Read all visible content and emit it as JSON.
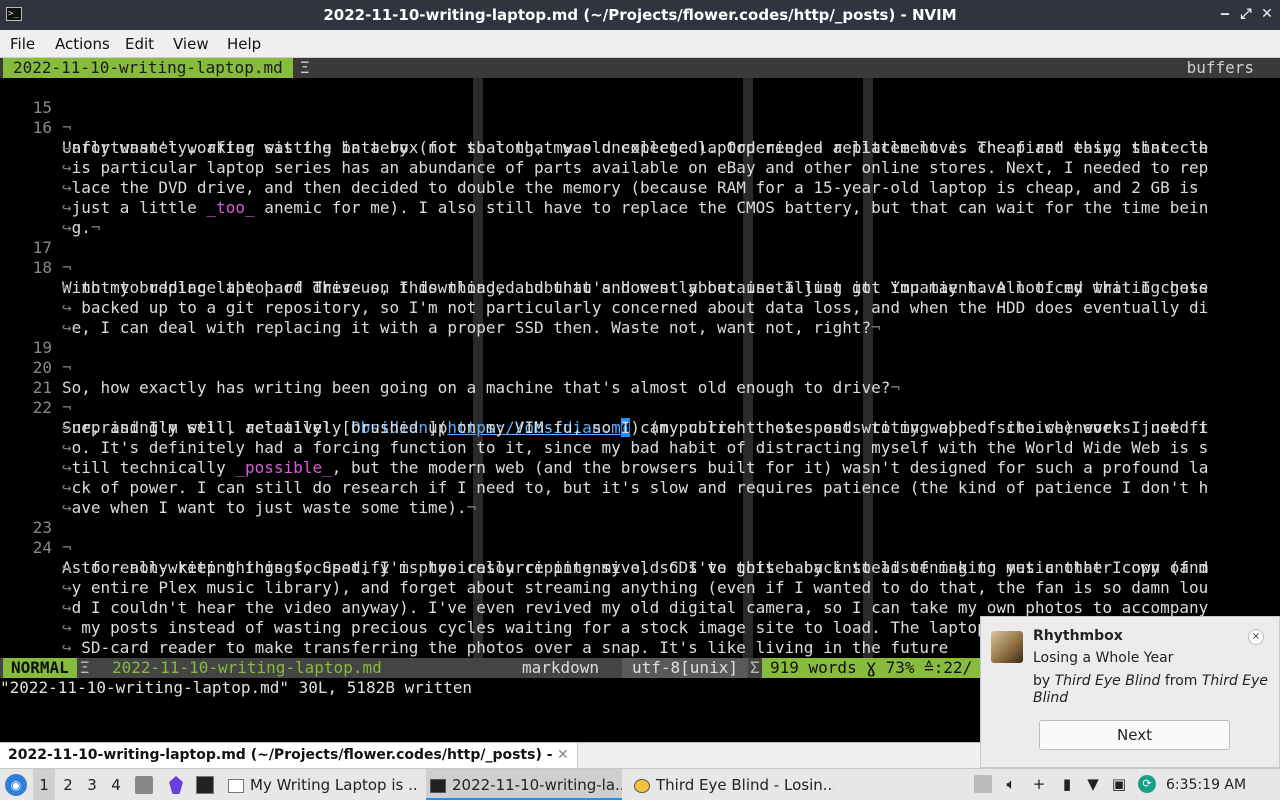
{
  "window": {
    "title": "2022-11-10-writing-laptop.md (~/Projects/flower.codes/http/_posts) - NVIM",
    "minimize": "‒",
    "maximize": "⤢",
    "close": "✕"
  },
  "menu": {
    "items": [
      "File",
      "Actions",
      "Edit",
      "View",
      "Help"
    ]
  },
  "tabline": {
    "active_buffer": "2022-11-10-writing-laptop.md",
    "right_label": "buffers"
  },
  "editor": {
    "wrap_marker": "↪",
    "eol_marker": "¬",
    "line_15": "15",
    "line_16": "16",
    "line_16_a": "Unfortunately, after sitting in a box for so long, my old college laptop needed a little love. The first thing that cle",
    "line_16_b": "arly wasn't working was the battery (not that that was unexpected). Ordering a replacement is cheap and easy, since th",
    "line_16_c": "is particular laptop series has an abundance of parts available on eBay and other online stores. Next, I needed to rep",
    "line_16_d": "lace the DVD drive, and then decided to double the memory (because RAM for a 15-year-old laptop is cheap, and 2 GB is",
    "line_16_e1": "just a little ",
    "line_16_e_em": "_too_",
    "line_16_e2": " anemic for me). I also still have to replace the CMOS battery, but that can wait for the time bein",
    "line_16_f": "g.",
    "line_17": "17",
    "line_18": "18",
    "line_18_a": "With my budding laptop of Theseus, I downloaded Lubuntu and went about installing it. You may have noticed that I chose",
    "line_18_b": " not to replace the hard drive on this thing, and that's honestly because I just got impatient. All of my writing gets",
    "line_18_c": " backed up to a git repository, so I'm not particularly concerned about data loss, and when the HDD does eventually di",
    "line_18_d": "e, I can deal with replacing it with a proper SSD then. Waste not, want not, right?",
    "line_19": "19",
    "line_20": "20",
    "line_20_a": "So, how exactly has writing been going on a machine that's almost old enough to drive?",
    "line_21": "21",
    "line_22": "22",
    "line_22_a1": "Surprisingly well, actually! [",
    "line_22_link": "Obsidian",
    "line_22_a2": "](",
    "line_22_url1": "https://obsidian.m",
    "line_22_cursor": "d",
    "line_22_a3": ") (my current notes and writing app of choice) works just fi",
    "line_22_b": "ne, and I'm still relatively brushed up on my VIM-fu, so I can publish these posts to my webbed site whenever I need t",
    "line_22_c": "o. It's definitely had a forcing function to it, since my bad habit of distracting myself with the World Wide Web is s",
    "line_22_d1": "till technically ",
    "line_22_d_em": "_possible_",
    "line_22_d2": ", but the modern web (and the browsers built for it) wasn't designed for such a profound la",
    "line_22_e": "ck of power. I can still do research if I need to, but it's slow and requires patience (the kind of patience I don't h",
    "line_22_f": "ave when I want to just waste some time).",
    "line_23": "23",
    "line_24": "24",
    "line_24_a": "As for non-writing things, Spotify is too resource intensive, so I've gotten back to listening to music that I own (and",
    "line_24_b": " to really keep things focused, I'm physically ripping my old CDs to this baby instead of making yet another copy of m",
    "line_24_c": "y entire Plex music library), and forget about streaming anything (even if I wanted to do that, the fan is so damn lou",
    "line_24_d": "d I couldn't hear the video anyway). I've even revived my old digital camera, so I can take my own photos to accompany",
    "line_24_e": " my posts instead of wasting precious cycles waiting for a stock image site to load. The laptop even has a handy-dandy",
    "line_24_f": " SD-card reader to make transferring the photos over a snap. It's like living in the future",
    "line_25": "25"
  },
  "statusline": {
    "mode": "NORMAL",
    "file_icon": "Ξ",
    "filename": "2022-11-10-writing-laptop.md",
    "filetype": "markdown",
    "encoding": "utf-8[unix]",
    "sep_icon": "Σ",
    "stats": "919 words Ɣ 73% ≙:22/"
  },
  "cmdline": {
    "message": "\"2022-11-10-writing-laptop.md\" 30L, 5182B written"
  },
  "tasklist": {
    "label": "2022-11-10-writing-laptop.md (~/Projects/flower.codes/http/_posts) - NVIM",
    "close": "✕"
  },
  "taskbar": {
    "workspaces": [
      "1",
      "2",
      "3",
      "4"
    ],
    "windows": [
      "My Writing Laptop is ...",
      "2022-11-10-writing-la...",
      "Third Eye Blind - Losin..."
    ],
    "plus": "+",
    "clock": "6:35:19 AM MST"
  },
  "notification": {
    "app": "Rhythmbox",
    "song": "Losing a Whole Year",
    "by_word": "by",
    "artist": "Third Eye Blind",
    "from_word": "from",
    "album": "Third Eye Blind",
    "action": "Next",
    "close": "×"
  },
  "colors": {
    "accent_green": "#87bb3c",
    "link_blue": "#5fafff",
    "emphasis_magenta": "#d75fd7",
    "titlebar": "#2f343f"
  }
}
